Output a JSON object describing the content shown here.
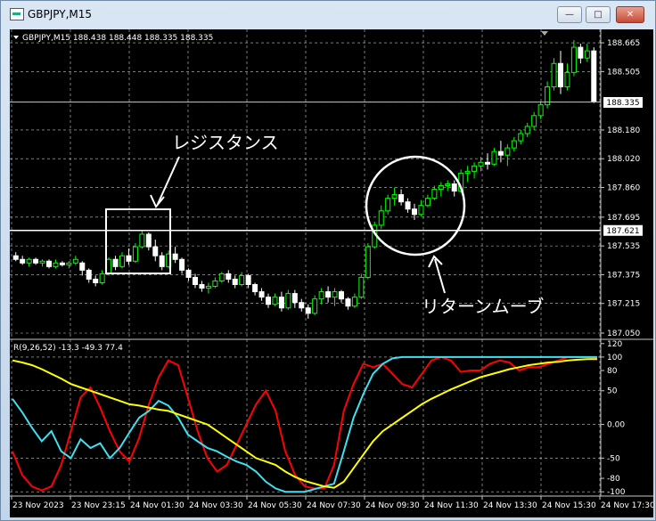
{
  "window": {
    "title": "GBPJPY,M15",
    "buttons": {
      "minimize": "—",
      "maximize": "□",
      "close": "✕"
    }
  },
  "chart_header": "GBPJPY,M15  188.438 188.448 188.335 188.335",
  "price_axis": [
    "188.665",
    "188.505",
    "188.335",
    "188.180",
    "188.020",
    "187.860",
    "187.695",
    "187.535",
    "187.375",
    "187.215",
    "187.050"
  ],
  "current_price": "188.335",
  "hline_price": "187.621",
  "indicator_header": "R(9,26,52) -13.3 -49.3 77.4",
  "indicator_axis": [
    "120",
    "100",
    "80",
    "50",
    "0.00",
    "-50",
    "-80",
    "-100"
  ],
  "time_axis": [
    "23 Nov 2023",
    "23 Nov 23:15",
    "24 Nov 01:30",
    "24 Nov 03:30",
    "24 Nov 05:30",
    "24 Nov 07:30",
    "24 Nov 09:30",
    "24 Nov 11:30",
    "24 Nov 13:30",
    "24 Nov 15:30",
    "24 Nov 17:30"
  ],
  "annotations": {
    "resistance": "レジスタンス",
    "return_move": "リターンムーブ"
  },
  "colors": {
    "bg": "#000000",
    "bull": "#00ff00",
    "bear": "#ffffff",
    "grid": "#c8c8c8",
    "red": "#ff0000",
    "cyan": "#40e0f0",
    "yellow": "#ffff00",
    "text": "#ffffff"
  },
  "chart_data": {
    "type": "candlestick",
    "timeframe": "M15",
    "ylim": [
      187.05,
      188.7
    ],
    "candles": [
      [
        187.48,
        187.5,
        187.45,
        187.46
      ],
      [
        187.46,
        187.48,
        187.43,
        187.44
      ],
      [
        187.44,
        187.47,
        187.42,
        187.46
      ],
      [
        187.46,
        187.47,
        187.43,
        187.44
      ],
      [
        187.44,
        187.46,
        187.42,
        187.45
      ],
      [
        187.45,
        187.46,
        187.41,
        187.42
      ],
      [
        187.42,
        187.46,
        187.41,
        187.44
      ],
      [
        187.44,
        187.45,
        187.42,
        187.43
      ],
      [
        187.43,
        187.45,
        187.41,
        187.44
      ],
      [
        187.44,
        187.48,
        187.43,
        187.46
      ],
      [
        187.44,
        187.45,
        187.37,
        187.4
      ],
      [
        187.4,
        187.41,
        187.33,
        187.35
      ],
      [
        187.35,
        187.37,
        187.31,
        187.33
      ],
      [
        187.33,
        187.4,
        187.32,
        187.38
      ],
      [
        187.38,
        187.47,
        187.37,
        187.46
      ],
      [
        187.46,
        187.48,
        187.4,
        187.42
      ],
      [
        187.42,
        187.5,
        187.41,
        187.48
      ],
      [
        187.48,
        187.52,
        187.43,
        187.45
      ],
      [
        187.45,
        187.55,
        187.44,
        187.53
      ],
      [
        187.53,
        187.62,
        187.52,
        187.6
      ],
      [
        187.6,
        187.61,
        187.51,
        187.53
      ],
      [
        187.53,
        187.57,
        187.45,
        187.48
      ],
      [
        187.48,
        187.5,
        187.4,
        187.42
      ],
      [
        187.42,
        187.51,
        187.41,
        187.49
      ],
      [
        187.49,
        187.53,
        187.44,
        187.46
      ],
      [
        187.46,
        187.47,
        187.38,
        187.4
      ],
      [
        187.4,
        187.41,
        187.34,
        187.36
      ],
      [
        187.36,
        187.38,
        187.3,
        187.32
      ],
      [
        187.32,
        187.34,
        187.28,
        187.3
      ],
      [
        187.3,
        187.33,
        187.27,
        187.31
      ],
      [
        187.31,
        187.36,
        187.3,
        187.34
      ],
      [
        187.34,
        187.39,
        187.33,
        187.38
      ],
      [
        187.38,
        187.4,
        187.33,
        187.35
      ],
      [
        187.35,
        187.37,
        187.3,
        187.32
      ],
      [
        187.32,
        187.39,
        187.31,
        187.37
      ],
      [
        187.37,
        187.38,
        187.3,
        187.32
      ],
      [
        187.32,
        187.33,
        187.26,
        187.28
      ],
      [
        187.28,
        187.3,
        187.23,
        187.25
      ],
      [
        187.25,
        187.27,
        187.19,
        187.21
      ],
      [
        187.21,
        187.27,
        187.2,
        187.25
      ],
      [
        187.25,
        187.28,
        187.17,
        187.19
      ],
      [
        187.19,
        187.29,
        187.18,
        187.27
      ],
      [
        187.27,
        187.29,
        187.19,
        187.22
      ],
      [
        187.22,
        187.24,
        187.17,
        187.19
      ],
      [
        187.19,
        187.21,
        187.13,
        187.16
      ],
      [
        187.16,
        187.26,
        187.15,
        187.24
      ],
      [
        187.24,
        187.3,
        187.21,
        187.28
      ],
      [
        187.28,
        187.31,
        187.22,
        187.25
      ],
      [
        187.25,
        187.3,
        187.2,
        187.28
      ],
      [
        187.28,
        187.29,
        187.22,
        187.24
      ],
      [
        187.24,
        187.25,
        187.18,
        187.2
      ],
      [
        187.2,
        187.27,
        187.19,
        187.25
      ],
      [
        187.25,
        187.38,
        187.24,
        187.36
      ],
      [
        187.36,
        187.55,
        187.35,
        187.53
      ],
      [
        187.53,
        187.67,
        187.52,
        187.65
      ],
      [
        187.65,
        187.76,
        187.63,
        187.73
      ],
      [
        187.73,
        187.82,
        187.71,
        187.8
      ],
      [
        187.8,
        187.86,
        187.76,
        187.82
      ],
      [
        187.82,
        187.85,
        187.76,
        187.78
      ],
      [
        187.78,
        187.8,
        187.72,
        187.74
      ],
      [
        187.74,
        187.77,
        187.68,
        187.71
      ],
      [
        187.71,
        187.79,
        187.7,
        187.76
      ],
      [
        187.76,
        187.82,
        187.75,
        187.8
      ],
      [
        187.8,
        187.87,
        187.79,
        187.85
      ],
      [
        187.85,
        187.89,
        187.81,
        187.87
      ],
      [
        187.87,
        187.9,
        187.84,
        187.88
      ],
      [
        187.88,
        187.9,
        187.81,
        187.84
      ],
      [
        187.84,
        187.96,
        187.83,
        187.94
      ],
      [
        187.94,
        187.98,
        187.89,
        187.95
      ],
      [
        187.95,
        188.0,
        187.91,
        187.98
      ],
      [
        187.98,
        188.03,
        187.95,
        188.0
      ],
      [
        188.0,
        188.05,
        187.96,
        187.99
      ],
      [
        187.99,
        188.08,
        187.98,
        188.06
      ],
      [
        188.06,
        188.12,
        188.0,
        188.04
      ],
      [
        188.04,
        188.1,
        187.98,
        188.08
      ],
      [
        188.08,
        188.14,
        188.06,
        188.12
      ],
      [
        188.12,
        188.18,
        188.1,
        188.16
      ],
      [
        188.16,
        188.22,
        188.14,
        188.2
      ],
      [
        188.2,
        188.28,
        188.18,
        188.26
      ],
      [
        188.26,
        188.34,
        188.24,
        188.32
      ],
      [
        188.32,
        188.45,
        188.3,
        188.42
      ],
      [
        188.42,
        188.58,
        188.4,
        188.55
      ],
      [
        188.55,
        188.62,
        188.38,
        188.42
      ],
      [
        188.42,
        188.55,
        188.4,
        188.5
      ],
      [
        188.5,
        188.68,
        188.48,
        188.64
      ],
      [
        188.64,
        188.66,
        188.55,
        188.58
      ],
      [
        188.58,
        188.66,
        188.56,
        188.62
      ],
      [
        188.62,
        188.64,
        188.33,
        188.34
      ]
    ],
    "hline": 187.621,
    "indicator": {
      "name": "R(9,26,52)",
      "values": [
        -13.3,
        -49.3,
        77.4
      ],
      "ylim": [
        -105,
        125
      ],
      "series": [
        {
          "color": "red",
          "values": [
            -40,
            -75,
            -92,
            -98,
            -92,
            -60,
            -10,
            40,
            55,
            25,
            -10,
            -40,
            -55,
            -20,
            30,
            70,
            95,
            88,
            40,
            -10,
            -50,
            -70,
            -60,
            -30,
            0,
            30,
            50,
            20,
            -40,
            -75,
            -92,
            -95,
            -95,
            -60,
            20,
            60,
            90,
            85,
            90,
            75,
            60,
            55,
            75,
            95,
            100,
            95,
            78,
            80,
            80,
            90,
            95,
            92,
            80,
            85,
            85,
            90,
            95,
            100,
            100,
            100,
            98
          ]
        },
        {
          "color": "cyan",
          "values": [
            38,
            18,
            -5,
            -25,
            -10,
            -40,
            -50,
            -22,
            -35,
            -28,
            -50,
            -35,
            -12,
            10,
            20,
            35,
            28,
            10,
            -15,
            -25,
            -35,
            -40,
            -48,
            -55,
            -60,
            -70,
            -85,
            -95,
            -100,
            -100,
            -100,
            -96,
            -92,
            -88,
            -40,
            10,
            45,
            75,
            90,
            98,
            100,
            100,
            100,
            100,
            100,
            100,
            100,
            100,
            100,
            100,
            100,
            100,
            100,
            100,
            100,
            100,
            100,
            100,
            100,
            100,
            100
          ]
        },
        {
          "color": "yellow",
          "values": [
            95,
            92,
            88,
            82,
            75,
            68,
            60,
            55,
            50,
            45,
            40,
            35,
            30,
            28,
            25,
            22,
            20,
            15,
            10,
            5,
            0,
            -10,
            -20,
            -30,
            -40,
            -50,
            -55,
            -60,
            -70,
            -78,
            -84,
            -88,
            -92,
            -94,
            -85,
            -65,
            -45,
            -25,
            -10,
            0,
            10,
            20,
            30,
            38,
            45,
            52,
            58,
            64,
            70,
            74,
            78,
            82,
            85,
            88,
            90,
            92,
            93,
            95,
            96,
            97,
            97
          ]
        }
      ]
    }
  }
}
